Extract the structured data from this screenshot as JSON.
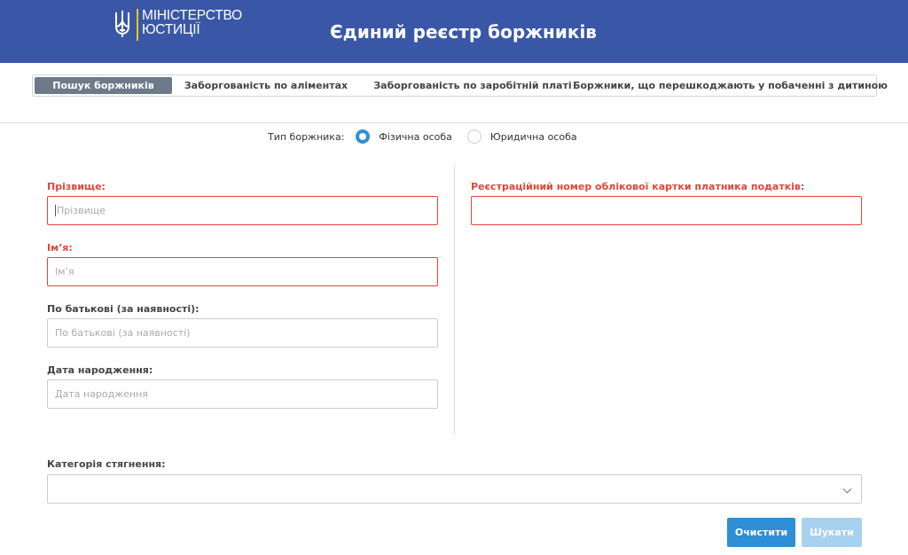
{
  "header": {
    "logo_line1": "МІНІСТЕРСТВО",
    "logo_line2": "ЮСТИЦІЇ",
    "logo_icon": "trident-icon",
    "title": "Єдиний реєстр боржників",
    "bg_color": "#3a57a7"
  },
  "tabs": [
    {
      "label": "Пошук боржників",
      "active": true
    },
    {
      "label": "Заборгованість по аліментах",
      "active": false
    },
    {
      "label": "Заборгованість по заробітній платі",
      "active": false
    },
    {
      "label": "Боржники, що перешкоджають у побаченні з дитиною",
      "active": false
    }
  ],
  "debtor_type": {
    "label": "Тип боржника:",
    "options": [
      {
        "label": "Фізична особа",
        "checked": true
      },
      {
        "label": "Юридична особа",
        "checked": false
      }
    ]
  },
  "form": {
    "surname": {
      "label": "Прізвище:",
      "placeholder": "Прізвище"
    },
    "name": {
      "label": "Ім’я:",
      "placeholder": "Ім’я"
    },
    "patronymic": {
      "label": "По батькові (за наявності):",
      "placeholder": "По батькові (за наявності)"
    },
    "birthdate": {
      "label": "Дата народження:",
      "placeholder": "Дата народження"
    },
    "tax_number": {
      "label": "Реєстраційний номер облікової картки платника податків:",
      "value": ""
    },
    "category": {
      "label": "Категорія стягнення:",
      "value": ""
    }
  },
  "buttons": {
    "clear": "Очистити",
    "search": "Шукати"
  },
  "colors": {
    "accent": "#2f8fd6",
    "error": "#e2463a",
    "tab_active": "#6d7a89"
  }
}
